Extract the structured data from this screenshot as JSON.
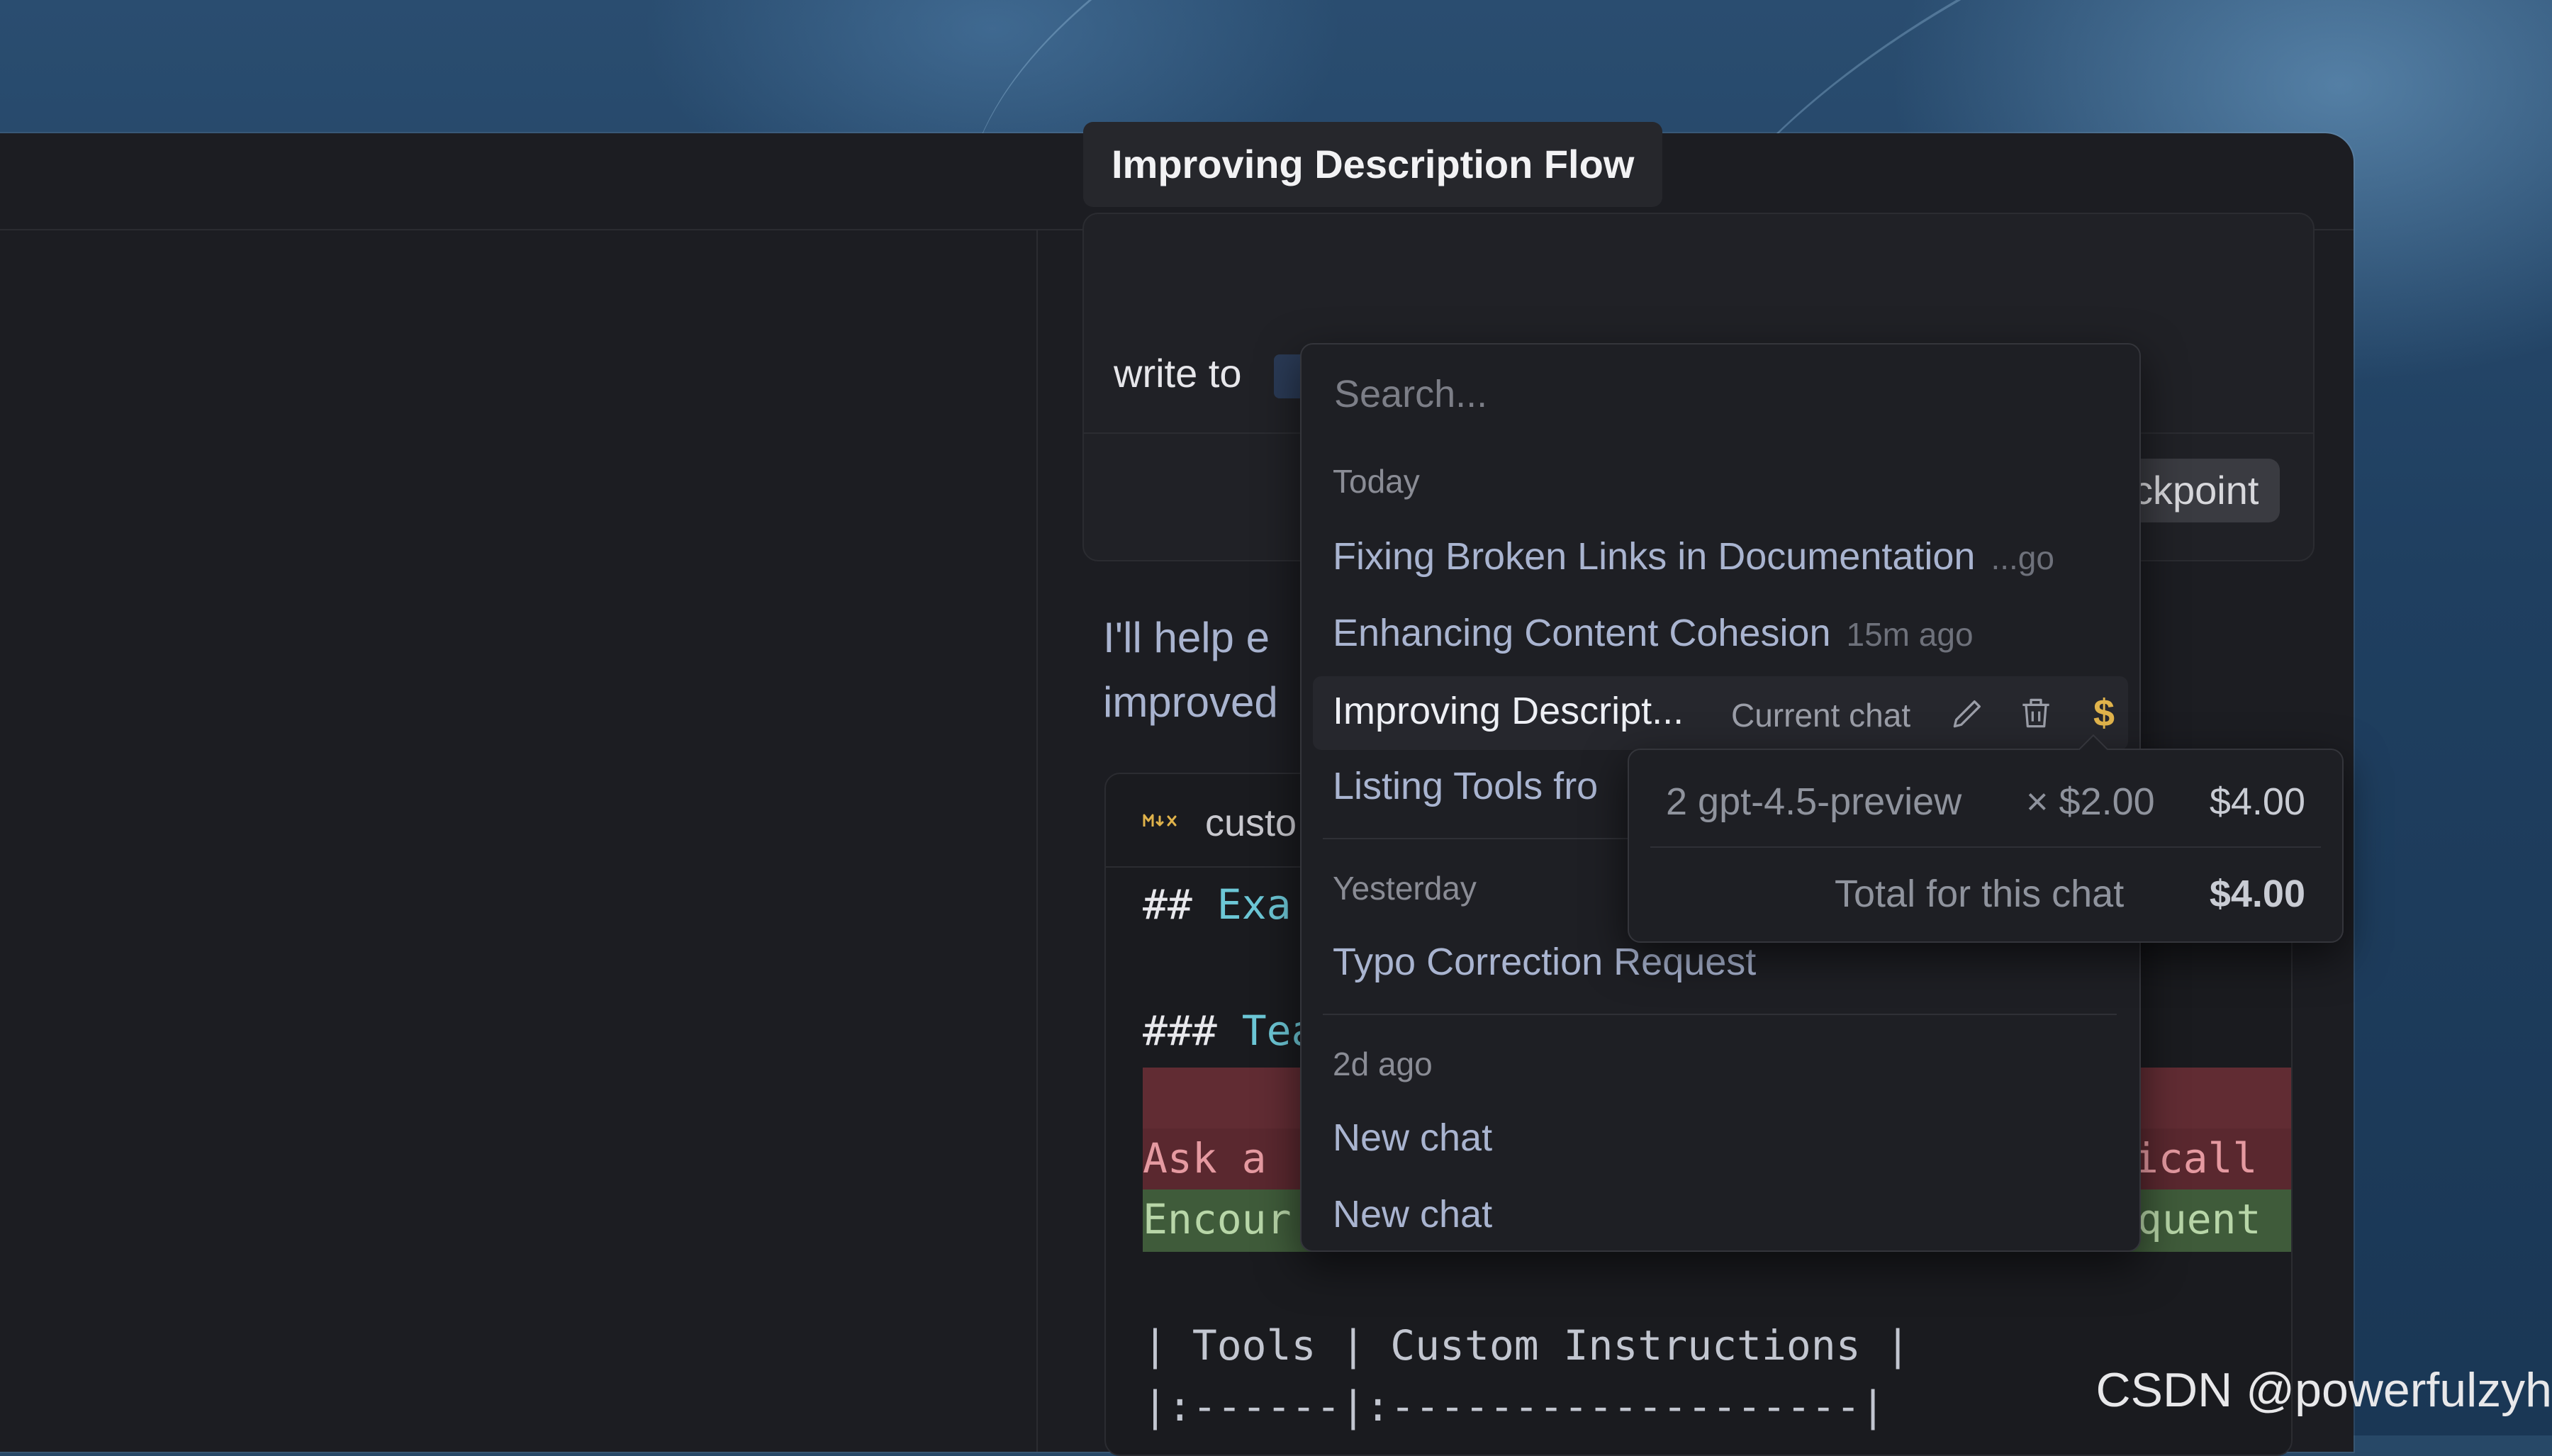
{
  "chat": {
    "title": "Improving Description Flow",
    "user_message_start": "write to",
    "checkpoint_label": "ckpoint",
    "assistant_line1": "I'll help e",
    "assistant_line2": "improved"
  },
  "code": {
    "file_name": "custo",
    "lines": {
      "h2_hash": "##",
      "h2_text": "Exa",
      "h3_hash": "###",
      "h3_text": "Tea",
      "del_left": "Ask a ",
      "del_right": "aticall",
      "add_left": "Encour",
      "add_right": "equent",
      "table_header": "| Tools | Custom Instructions |",
      "table_sep": "|:------|:-------------------|"
    }
  },
  "history": {
    "search_placeholder": "Search...",
    "sections": [
      {
        "label": "Today"
      },
      {
        "label": "Yesterday"
      },
      {
        "label": "2d ago"
      }
    ],
    "items": {
      "fixing": {
        "title": "Fixing Broken Links in Documentation",
        "time": "...go"
      },
      "enhancing": {
        "title": "Enhancing Content Cohesion",
        "time": "15m ago"
      },
      "current": {
        "title": "Improving Descript...",
        "badge": "Current chat"
      },
      "listing": {
        "title": "Listing Tools fro"
      },
      "typo": {
        "title": "Typo Correction Request"
      },
      "new1": {
        "title": "New chat"
      },
      "new2": {
        "title": "New chat"
      }
    }
  },
  "cost": {
    "line_model": "2 gpt-4.5-preview",
    "line_rate": "× $2.00",
    "line_amount": "$4.00",
    "total_label": "Total for this chat",
    "total_value": "$4.00"
  },
  "watermark": "CSDN @powerfulzyh",
  "icons": [
    "plus-icon",
    "history-icon",
    "more-icon",
    "close-icon",
    "pencil-icon",
    "trash-icon",
    "dollar-icon",
    "markdown-icon"
  ],
  "colors": {
    "accent_dollar": "#e0b34b",
    "heading_teal": "#6cc7d6",
    "diff_del": "#612c33",
    "diff_add": "#3f5b3a"
  }
}
